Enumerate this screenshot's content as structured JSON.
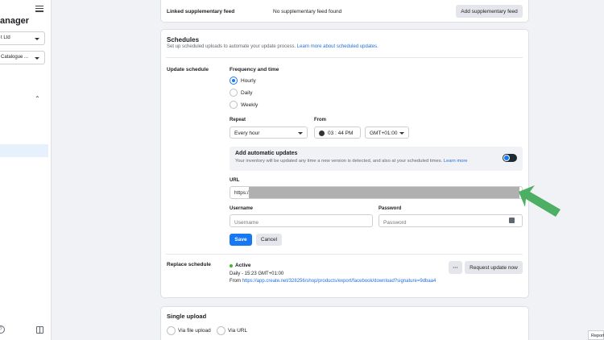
{
  "sidebar": {
    "title_partial": "anager",
    "business_select": "t Ltd",
    "catalogue_select": "Catalogue ..."
  },
  "supplementary": {
    "label": "Linked supplementary feed",
    "value": "No supplementary feed found",
    "button": "Add supplementary feed"
  },
  "schedules": {
    "title": "Schedules",
    "description": "Set up scheduled uploads to automate your update process.",
    "learn_more": "Learn more about scheduled updates.",
    "update_schedule_label": "Update schedule",
    "frequency_label": "Frequency and time",
    "frequency_options": [
      "Hourly",
      "Daily",
      "Weekly"
    ],
    "selected_frequency": "Hourly",
    "repeat_label": "Repeat",
    "repeat_value": "Every hour",
    "from_label": "From",
    "from_time": "03 : 44 PM",
    "timezone": "GMT+01:00",
    "auto_updates_title": "Add automatic updates",
    "auto_updates_desc": "Your inventory will be updated any time a new version is detected, and also at your scheduled times.",
    "auto_updates_link": "Learn more",
    "url_label": "URL",
    "url_value": "https://",
    "username_label": "Username",
    "username_placeholder": "Username",
    "password_label": "Password",
    "password_placeholder": "Password",
    "save_button": "Save",
    "cancel_button": "Cancel"
  },
  "replace_schedule": {
    "label": "Replace schedule",
    "status": "Active",
    "detail": "Daily - 15:23 GMT+01:00",
    "from_prefix": "From",
    "from_url": "https://app.create.net/328256/shop/products/export/facebook/download?signature=9dbaa4",
    "more_button": "···",
    "request_button": "Request update now"
  },
  "single_upload": {
    "title": "Single upload",
    "options": [
      "Via file upload",
      "Via URL"
    ]
  },
  "corner_label": "Report",
  "colors": {
    "accent": "#1877f2",
    "active_green": "#42b72a",
    "arrow_green": "#4caf63",
    "redaction": "#b0b0b0"
  }
}
